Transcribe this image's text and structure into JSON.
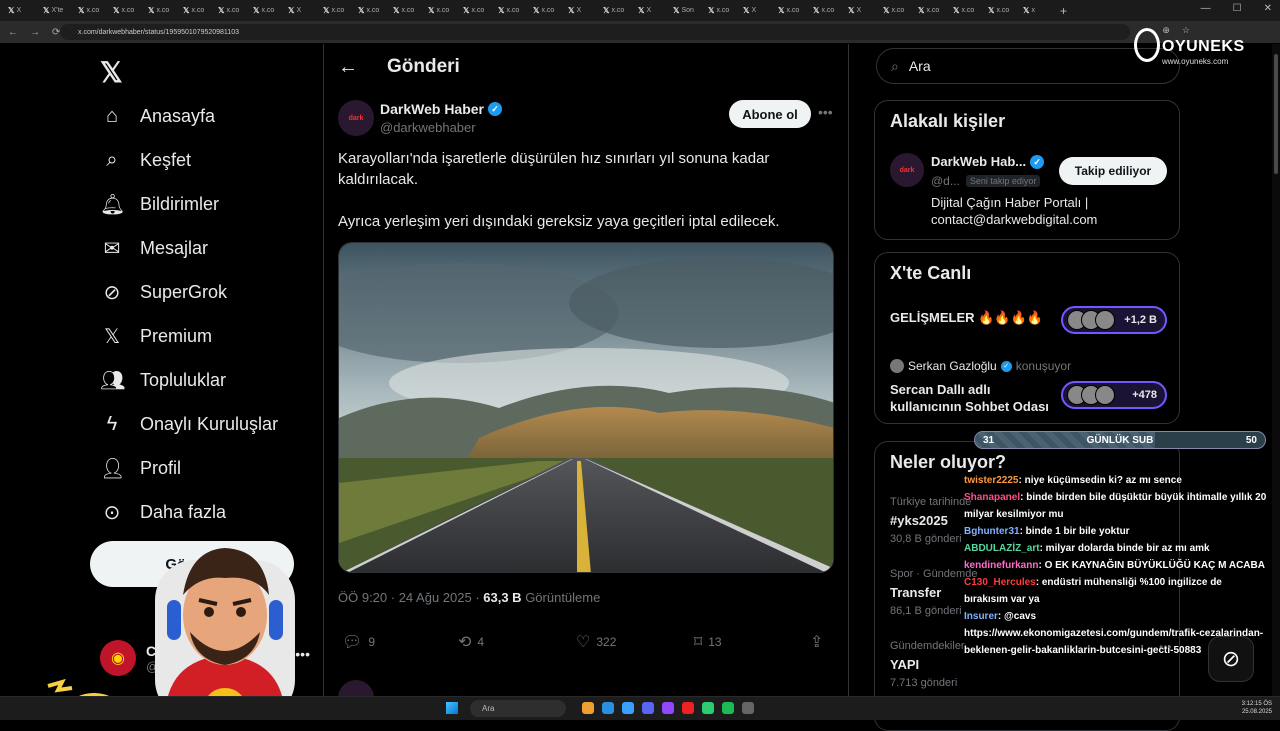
{
  "browser": {
    "tabs": [
      {
        "label": "X"
      },
      {
        "label": "X'te"
      },
      {
        "label": "x.co"
      },
      {
        "label": "x.co"
      },
      {
        "label": "x.co"
      },
      {
        "label": "x.co"
      },
      {
        "label": "x.co"
      },
      {
        "label": "x.co"
      },
      {
        "label": "X"
      },
      {
        "label": "x.co"
      },
      {
        "label": "x.co"
      },
      {
        "label": "x.co"
      },
      {
        "label": "x.co"
      },
      {
        "label": "x.co"
      },
      {
        "label": "x.co"
      },
      {
        "label": "x.co"
      },
      {
        "label": "X"
      },
      {
        "label": "x.co"
      },
      {
        "label": "X"
      },
      {
        "label": "Son"
      },
      {
        "label": "x.co"
      },
      {
        "label": "X"
      },
      {
        "label": "x.co"
      },
      {
        "label": "x.co"
      },
      {
        "label": "X"
      },
      {
        "label": "x.co"
      },
      {
        "label": "x.co"
      },
      {
        "label": "x.co"
      },
      {
        "label": "x.co"
      },
      {
        "label": "x"
      }
    ],
    "url": "x.com/darkwebhaber/status/1959501079520981103"
  },
  "overlay": {
    "brand": "OYUNEKS",
    "brand_url": "www.oyuneks.com",
    "subgoal": {
      "current": "31",
      "label": "GÜNLÜK SUB",
      "target": "50",
      "progress": 0.62
    },
    "chat": [
      {
        "user": "twister2225",
        "color": "#ff9a3c",
        "text": ": niye küçümsedin ki? az mı sence"
      },
      {
        "user": "Shanapanel",
        "color": "#ff4d8d",
        "text": ": binde birden bile düşüktür büyük ihtimalle yıllık 20 milyar kesilmiyor mu"
      },
      {
        "user": "Bghunter31",
        "color": "#7fb2ff",
        "text": ": binde 1 bir bile yoktur"
      },
      {
        "user": "ABDULAZİZ_art",
        "color": "#57d6a0",
        "text": ": milyar dolarda binde bir az mı amk"
      },
      {
        "user": "kendinefurkann",
        "color": "#ff6bcb",
        "text": ": O EK KAYNAĞIN BÜYÜKLÜĞÜ KAÇ M ACABA"
      },
      {
        "user": "C130_Hercules",
        "color": "#ff3b3b",
        "text": ": endüstri mühensliği %100 ingilizce de bırakısım var ya"
      },
      {
        "user": "Insurer",
        "color": "#7fb2ff",
        "text": ": @cavs https://www.ekonomigazetesi.com/gundem/trafik-cezalarindan-beklenen-gelir-bakanliklarin-butcesini-gecti-50883"
      }
    ]
  },
  "nav": {
    "items": [
      {
        "label": "Anasayfa",
        "icon": "home-icon"
      },
      {
        "label": "Keşfet",
        "icon": "search-icon"
      },
      {
        "label": "Bildirimler",
        "icon": "bell-icon"
      },
      {
        "label": "Mesajlar",
        "icon": "mail-icon"
      },
      {
        "label": "SuperGrok",
        "icon": "grok-icon"
      },
      {
        "label": "Premium",
        "icon": "x-icon"
      },
      {
        "label": "Topluluklar",
        "icon": "people-icon"
      },
      {
        "label": "Onaylı Kuruluşlar",
        "icon": "lightning-icon"
      },
      {
        "label": "Profil",
        "icon": "person-icon"
      },
      {
        "label": "Daha fazla",
        "icon": "more-circle-icon"
      }
    ],
    "post_button": "Gönder",
    "account_name": "C",
    "account_handle": "@c"
  },
  "main": {
    "title": "Gönderi",
    "author": {
      "name": "DarkWeb Haber",
      "handle": "@darkwebhaber",
      "avatar_text": "dark"
    },
    "subscribe": "Abone ol",
    "text_1": "Karayolları'nda işaretlerle düşürülen hız sınırları yıl sonuna kadar kaldırılacak.",
    "text_2": "Ayrıca yerleşim yeri dışındaki gereksiz yaya geçitleri iptal edilecek.",
    "time": "ÖÖ 9:20 · 24 Ağu 2025 · ",
    "views": "63,3 B",
    "views_label": " Görüntüleme",
    "replies": "9",
    "reposts": "4",
    "likes": "322",
    "bookmarks": "13"
  },
  "sidebar": {
    "search_placeholder": "Ara",
    "related_title": "Alakalı kişiler",
    "related": {
      "name": "DarkWeb Hab...",
      "handle": "@d...",
      "follows_you": "Seni takip ediyor",
      "follow_label": "Takip ediliyor",
      "bio": "Dijital Çağın Haber Portalı | contact@darkwebdigital.com"
    },
    "live_title": "X'te Canlı",
    "live": [
      {
        "title": "GELİŞMELER 🔥🔥🔥🔥",
        "count": "+1,2 B"
      },
      {
        "host": "Serkan Gazloğlu",
        "host_status": "konuşuyor",
        "title": "Sercan Dallı adlı kullanıcının Sohbet Odası",
        "count": "+478"
      }
    ],
    "trends_title": "Neler oluyor?",
    "trends": [
      {
        "meta": "Türkiye tarihinde",
        "name": "#yks2025",
        "count": "30,8 B gönderi"
      },
      {
        "meta": "Spor · Gündemde",
        "name": "Transfer",
        "count": "86,1 B gönderi"
      },
      {
        "meta": "Gündemdekiler",
        "name": "YAPI",
        "count": "7.713 gönderi"
      }
    ]
  },
  "taskbar": {
    "search": "Ara",
    "time": "3:12:15 ÖS",
    "date": "25.08.2025"
  }
}
